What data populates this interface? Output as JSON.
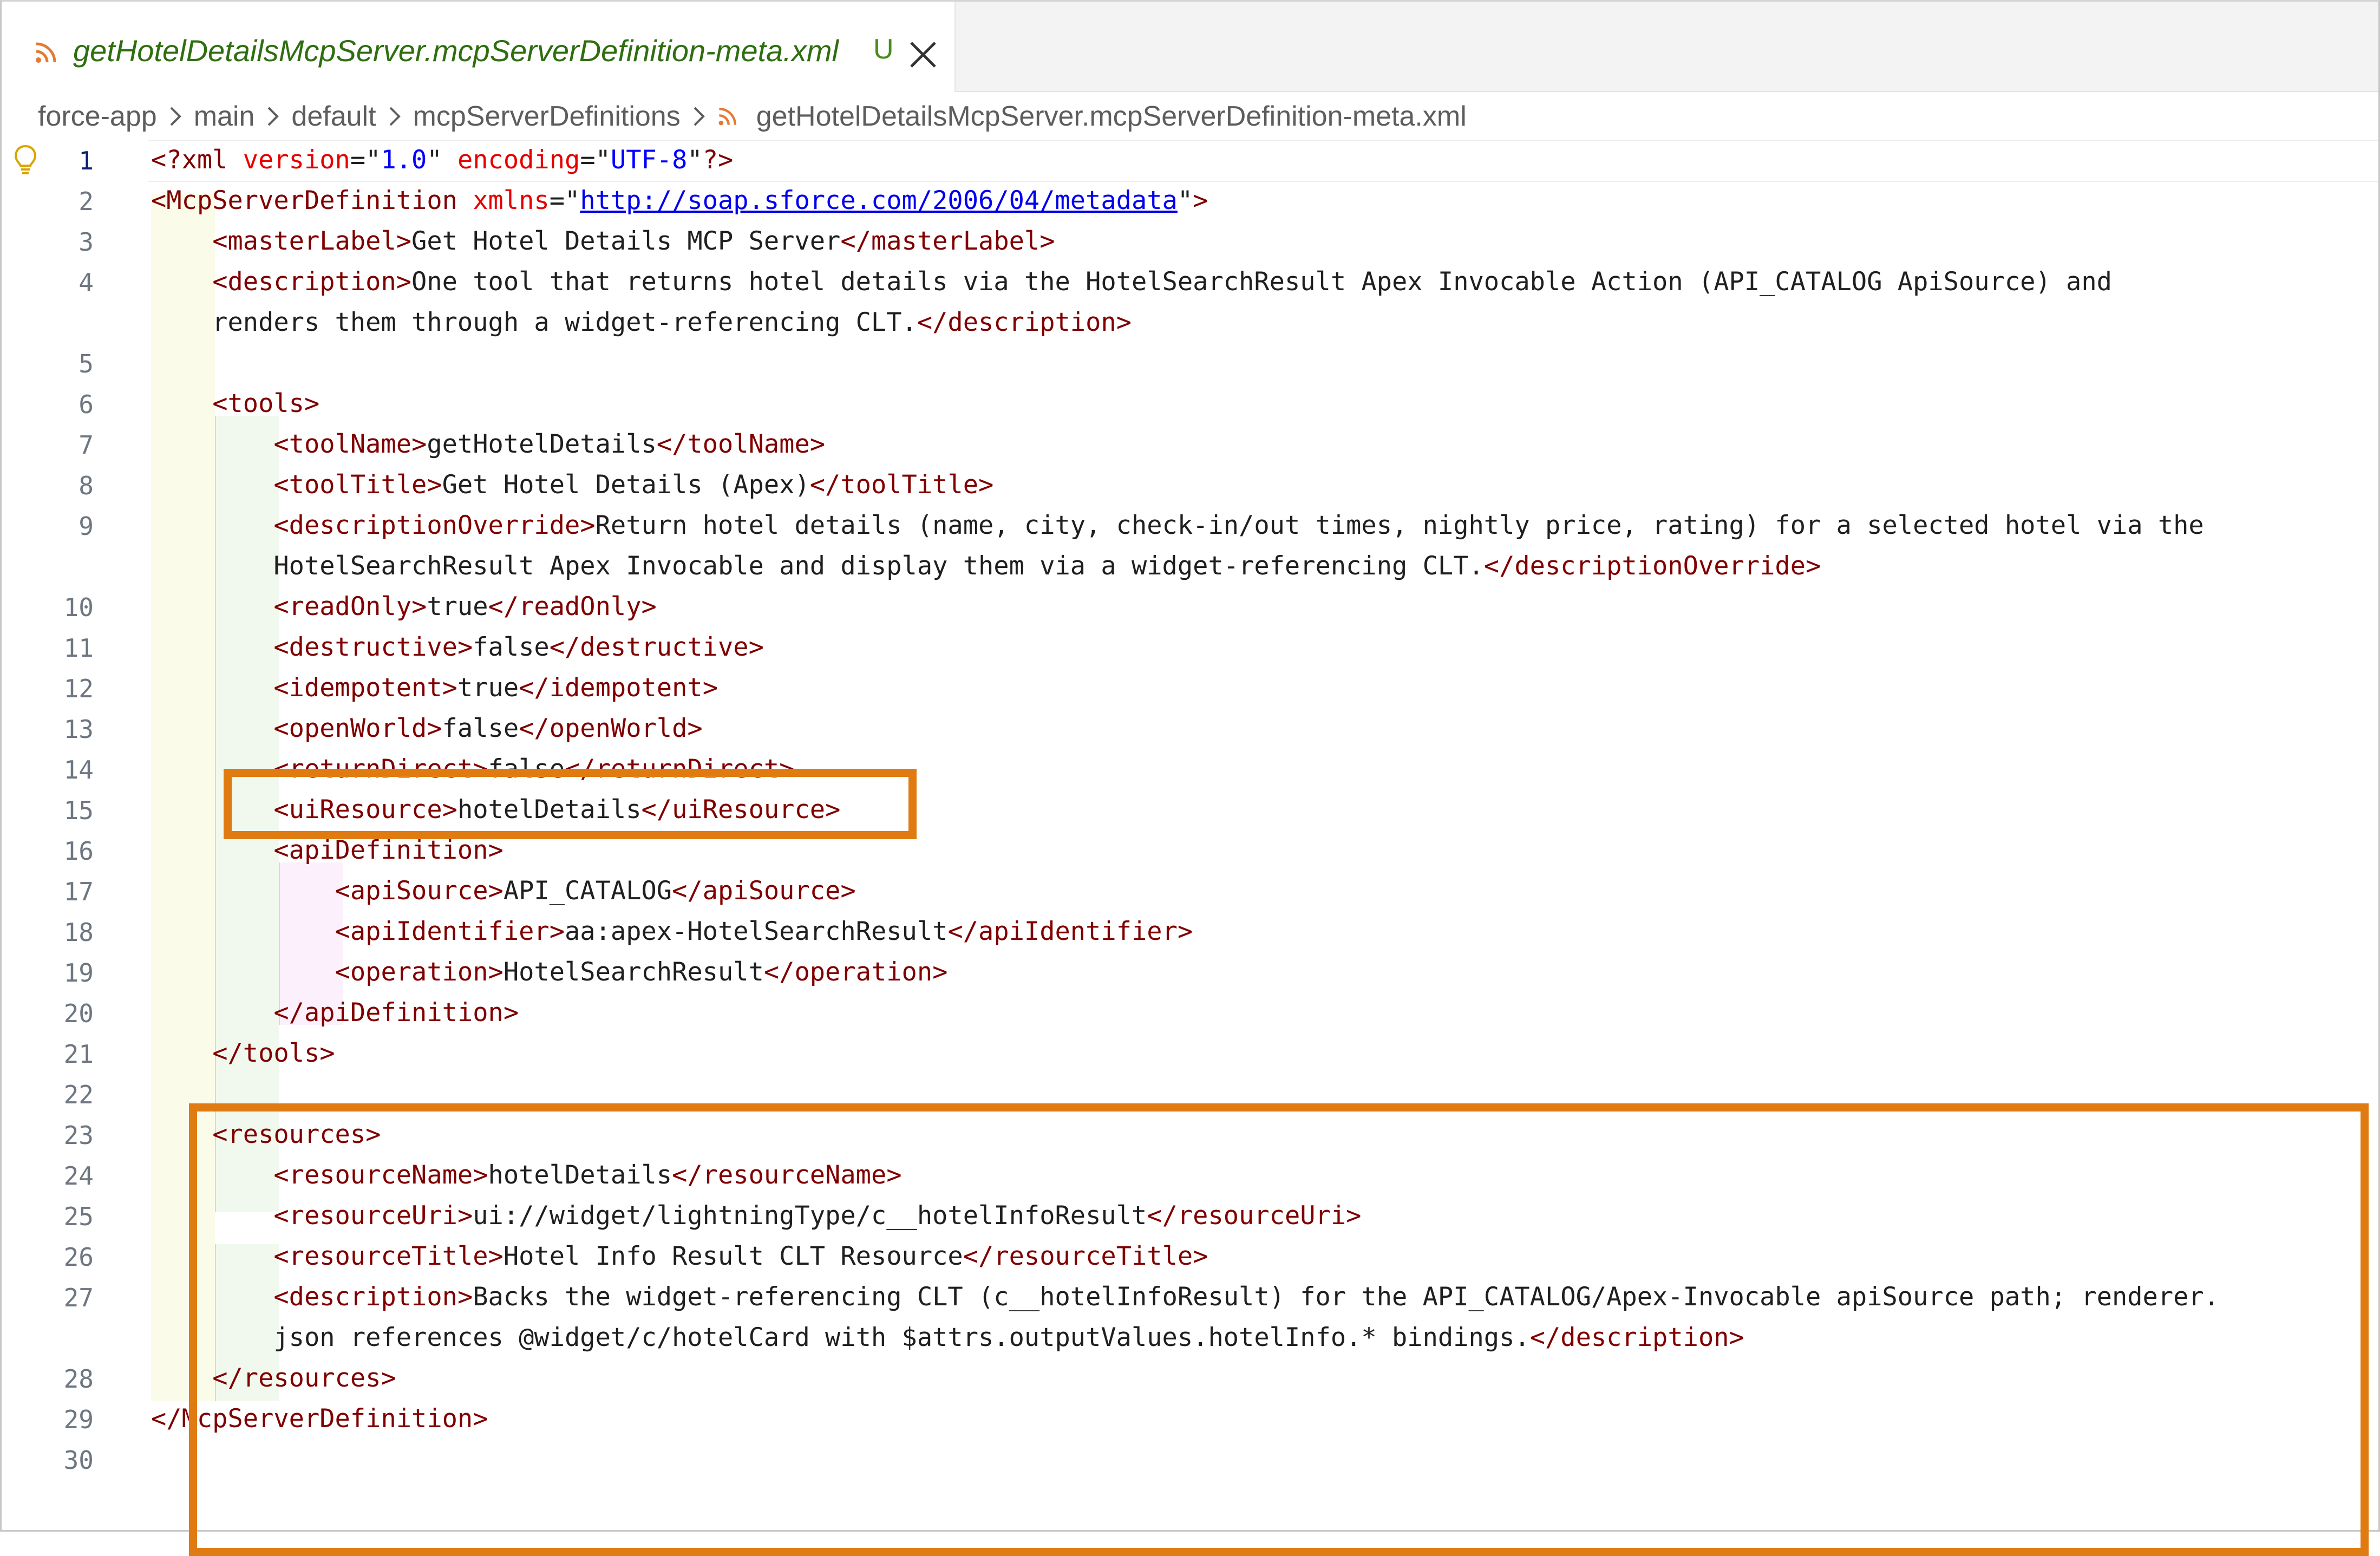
{
  "tab": {
    "title": "getHotelDetailsMcpServer.mcpServerDefinition-meta.xml",
    "git_status": "U",
    "icon": "rss-icon",
    "close_icon": "close-icon"
  },
  "breadcrumb": {
    "items": [
      "force-app",
      "main",
      "default",
      "mcpServerDefinitions"
    ],
    "file": "getHotelDetailsMcpServer.mcpServerDefinition-meta.xml"
  },
  "editor": {
    "active_line": 1,
    "colors": {
      "tag": "#800000",
      "attribute": "#e50000",
      "string": "#0000ff",
      "highlight_box": "#e07b12"
    },
    "line_numbers": [
      "1",
      "2",
      "3",
      "4",
      "",
      "5",
      "6",
      "7",
      "8",
      "9",
      "",
      "10",
      "11",
      "12",
      "13",
      "14",
      "15",
      "16",
      "17",
      "18",
      "19",
      "20",
      "21",
      "22",
      "23",
      "24",
      "25",
      "26",
      "27",
      "",
      "28",
      "29",
      "30"
    ],
    "lines": [
      "<?xml version=\"1.0\" encoding=\"UTF-8\"?>",
      "<McpServerDefinition xmlns=\"http://soap.sforce.com/2006/04/metadata\">",
      "    <masterLabel>Get Hotel Details MCP Server</masterLabel>",
      "    <description>One tool that returns hotel details via the HotelSearchResult Apex Invocable Action (API_CATALOG ApiSource) and",
      "    renders them through a widget-referencing CLT.</description>",
      "",
      "    <tools>",
      "        <toolName>getHotelDetails</toolName>",
      "        <toolTitle>Get Hotel Details (Apex)</toolTitle>",
      "        <descriptionOverride>Return hotel details (name, city, check-in/out times, nightly price, rating) for a selected hotel via the",
      "        HotelSearchResult Apex Invocable and display them via a widget-referencing CLT.</descriptionOverride>",
      "        <readOnly>true</readOnly>",
      "        <destructive>false</destructive>",
      "        <idempotent>true</idempotent>",
      "        <openWorld>false</openWorld>",
      "        <returnDirect>false</returnDirect>",
      "        <uiResource>hotelDetails</uiResource>",
      "        <apiDefinition>",
      "            <apiSource>API_CATALOG</apiSource>",
      "            <apiIdentifier>aa:apex-HotelSearchResult</apiIdentifier>",
      "            <operation>HotelSearchResult</operation>",
      "        </apiDefinition>",
      "    </tools>",
      "",
      "    <resources>",
      "        <resourceName>hotelDetails</resourceName>",
      "        <resourceUri>ui://widget/lightningType/c__hotelInfoResult</resourceUri>",
      "        <resourceTitle>Hotel Info Result CLT Resource</resourceTitle>",
      "        <description>Backs the widget-referencing CLT (c__hotelInfoResult) for the API_CATALOG/Apex-Invocable apiSource path; renderer.",
      "        json references @widget/c/hotelCard with $attrs.outputValues.hotelInfo.* bindings.</description>",
      "    </resources>",
      "</McpServerDefinition>",
      ""
    ]
  }
}
